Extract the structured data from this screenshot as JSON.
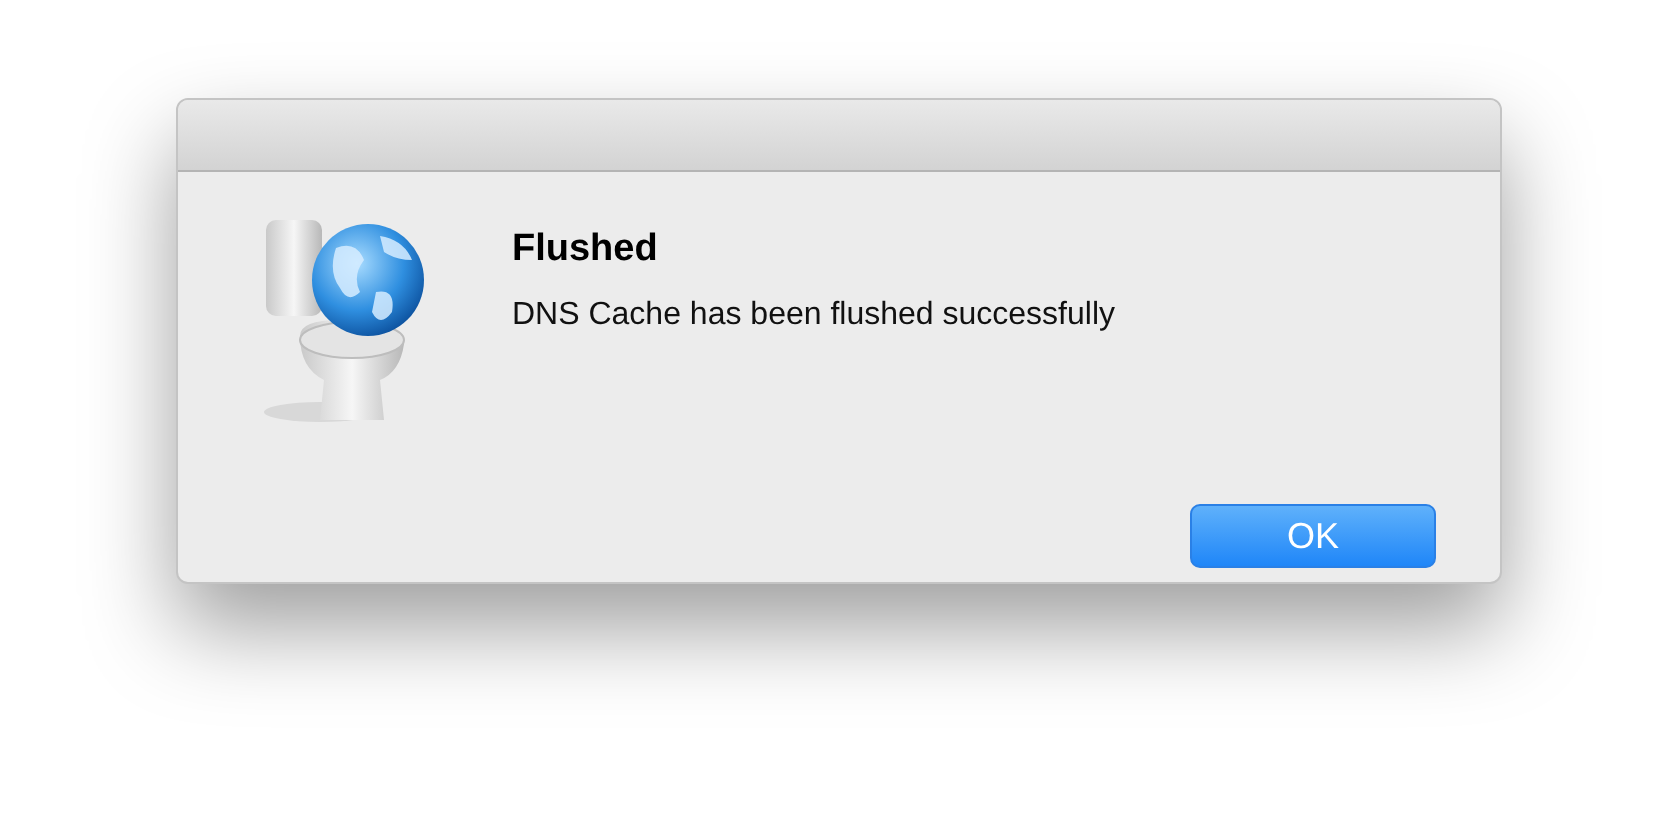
{
  "dialog": {
    "title": "Flushed",
    "message": "DNS Cache has been flushed successfully"
  },
  "buttons": [
    {
      "label": "OK",
      "default": true
    }
  ]
}
